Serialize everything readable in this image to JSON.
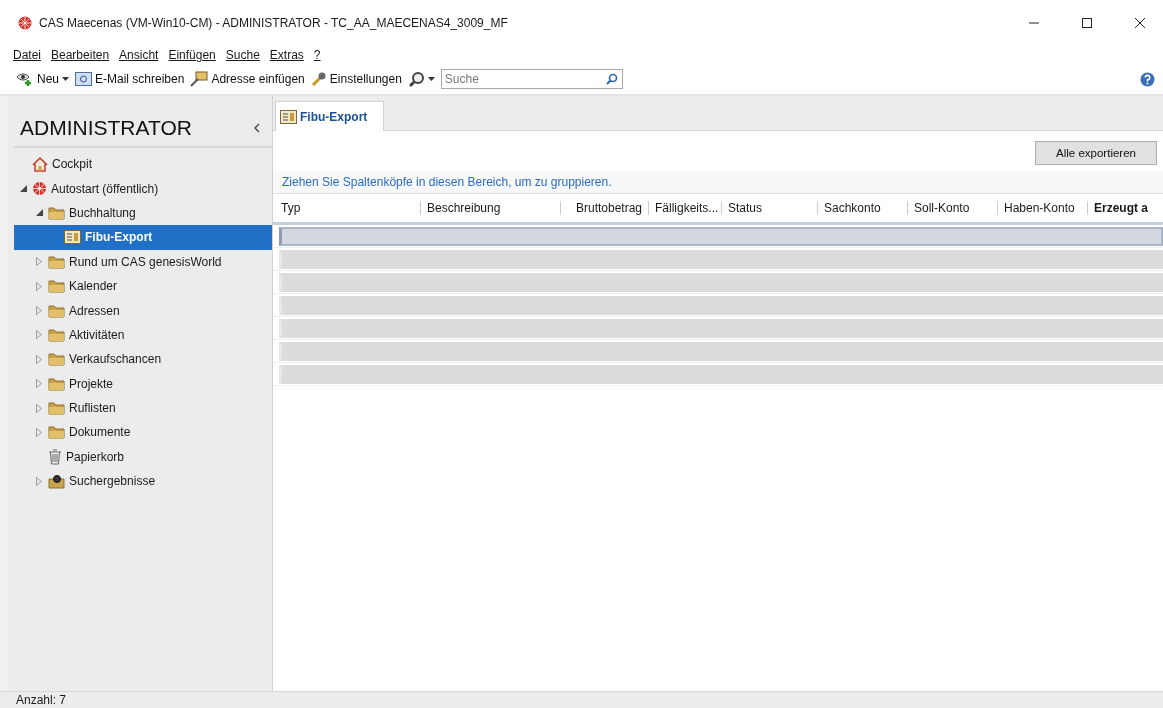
{
  "window": {
    "title": "CAS Maecenas (VM-Win10-CM) - ADMINISTRATOR - TC_AA_MAECENAS4_3009_MF"
  },
  "menu": [
    "Datei",
    "Bearbeiten",
    "Ansicht",
    "Einfügen",
    "Suche",
    "Extras",
    "?"
  ],
  "toolbar": [
    {
      "kind": "new",
      "label": "Neu"
    },
    {
      "kind": "mail",
      "label": "E-Mail schreiben"
    },
    {
      "kind": "address",
      "label": "Adresse einfügen"
    },
    {
      "kind": "settings",
      "label": "Einstellungen"
    },
    {
      "kind": "search"
    }
  ],
  "search": {
    "placeholder": "Suche"
  },
  "sidebar": {
    "title": "ADMINISTRATOR",
    "tree": [
      {
        "label": "Cockpit",
        "kind": "home",
        "selected": false
      },
      {
        "label": "Autostart (öffentlich)",
        "kind": "globe",
        "selected": false,
        "expanded": true,
        "children": [
          {
            "label": "Buchhaltung",
            "kind": "folder",
            "selected": false,
            "expanded": true,
            "children": [
              {
                "label": "Fibu-Export",
                "kind": "report",
                "selected": true
              }
            ]
          },
          {
            "label": "Rund um CAS genesisWorld",
            "kind": "folder",
            "selected": false,
            "expanded": false
          },
          {
            "label": "Kalender",
            "kind": "folder",
            "selected": false,
            "expanded": false
          },
          {
            "label": "Adressen",
            "kind": "folder",
            "selected": false,
            "expanded": false
          },
          {
            "label": "Aktivitäten",
            "kind": "folder",
            "selected": false,
            "expanded": false
          },
          {
            "label": "Verkaufschancen",
            "kind": "folder",
            "selected": false,
            "expanded": false
          },
          {
            "label": "Projekte",
            "kind": "folder",
            "selected": false,
            "expanded": false
          },
          {
            "label": "Ruflisten",
            "kind": "folder",
            "selected": false,
            "expanded": false
          },
          {
            "label": "Dokumente",
            "kind": "folder",
            "selected": false,
            "expanded": false
          },
          {
            "label": "Papierkorb",
            "kind": "trash",
            "selected": false
          },
          {
            "label": "Suchergebnisse",
            "kind": "search",
            "selected": false,
            "expanded": false
          }
        ]
      }
    ]
  },
  "tabs": [
    {
      "label": "Fibu-Export",
      "selected": true
    }
  ],
  "export_button": "Alle exportieren",
  "group_hint": "Ziehen Sie Spaltenköpfe in diesen Bereich, um zu gruppieren.",
  "table": {
    "columns": [
      "Typ",
      "Beschreibung",
      "Bruttobetrag",
      "Fälligkeits...",
      "Status",
      "Sachkonto",
      "Soll-Konto",
      "Haben-Konto",
      "Erzeugt a"
    ],
    "rows": [
      {
        "selected": true
      },
      {
        "selected": false
      },
      {
        "selected": false
      },
      {
        "selected": false
      },
      {
        "selected": false
      },
      {
        "selected": false
      },
      {
        "selected": false
      }
    ]
  },
  "status_bar": "Anzahl: 7"
}
